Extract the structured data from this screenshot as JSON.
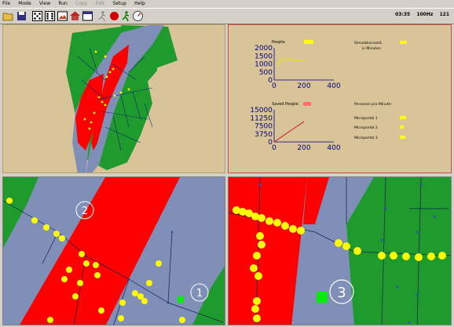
{
  "menu": [
    "File",
    "Mode",
    "View",
    "Run",
    "Copy",
    "Edit",
    "Setup",
    "Help"
  ],
  "menu_disabled": [
    "Copy",
    "Edit"
  ],
  "toolbar_icons": [
    "open-folder-icon",
    "save-disk-icon",
    "dice-icon",
    "dice-icon",
    "image-icon",
    "house-icon",
    "window-icon",
    "runner-icon",
    "record-icon",
    "person-icon",
    "gauge-icon"
  ],
  "status": {
    "time": "03:35",
    "rate": "100Hz",
    "value": "121"
  },
  "charts": {
    "people": {
      "title": "People",
      "badge": "1200",
      "yticks": [
        "2000",
        "1500",
        "1000",
        "500",
        "0"
      ],
      "xticks": [
        "0",
        "200",
        "400"
      ]
    },
    "saved": {
      "title": "Saved People",
      "yticks": [
        "15000",
        "11250",
        "7500",
        "3750",
        "0"
      ],
      "xticks": [
        "0",
        "200",
        "400"
      ]
    }
  },
  "info": {
    "sim_label_1": "Simulationszeit,",
    "sim_label_2": "in Minuten",
    "ppm_title": "Personen pro Minute:",
    "micro1": "Microportal 1",
    "micro2": "Microportal 2",
    "micro3": "Microportal 3"
  },
  "markers": {
    "m1": "1",
    "m2": "2",
    "m3": "3"
  },
  "colors": {
    "water": "#7f8fb8",
    "land": "#1f9a2c",
    "flood": "#ff0000",
    "people": "#ffff00",
    "frame": "#d0c090"
  },
  "chart_data": [
    {
      "type": "line",
      "title": "People",
      "xlim": [
        0,
        400
      ],
      "ylim": [
        0,
        2000
      ],
      "series": [
        {
          "values_x": [
            20,
            40,
            60,
            80,
            100,
            120,
            140,
            160,
            180,
            200
          ],
          "values_y": [
            900,
            1200,
            1300,
            1250,
            1300,
            1250,
            1200,
            1250,
            1200,
            1200
          ]
        }
      ]
    },
    {
      "type": "line",
      "title": "Saved People",
      "xlim": [
        0,
        400
      ],
      "ylim": [
        0,
        15000
      ],
      "series": [
        {
          "values_x": [
            0,
            200
          ],
          "values_y": [
            0,
            9500
          ]
        }
      ]
    }
  ]
}
